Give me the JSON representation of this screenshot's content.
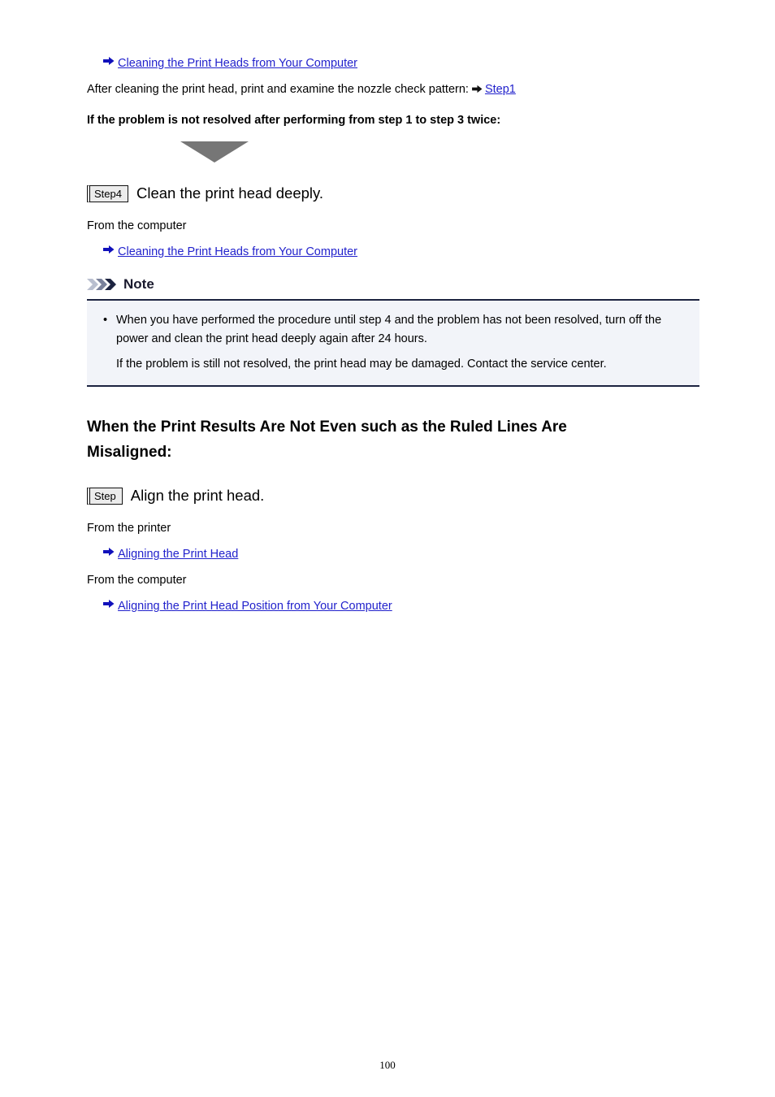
{
  "document": {
    "page_number": "100"
  },
  "top_section": {
    "link_cleaning_computer": "Cleaning the Print Heads from Your Computer",
    "after_clean_text": "After cleaning the print head, print and examine the nozzle check pattern:",
    "step1_link": "Step1",
    "problem_not_resolved": "If the problem is not resolved after performing from step 1 to step 3 twice:"
  },
  "step4": {
    "badge": "Step4",
    "title": "Clean the print head deeply.",
    "from_computer_label": "From the computer",
    "link_cleaning_computer": "Cleaning the Print Heads from Your Computer"
  },
  "note": {
    "title": "Note",
    "bullet": "•",
    "bullet_text": "When you have performed the procedure until step 4 and the problem has not been resolved, turn off the power and clean the print head deeply again after 24 hours.",
    "sub_text": "If the problem is still not resolved, the print head may be damaged. Contact the service center."
  },
  "align_section": {
    "heading": "When the Print Results Are Not Even such as the Ruled Lines Are Misaligned:",
    "badge": "Step",
    "title": "Align the print head.",
    "from_printer_label": "From the printer",
    "link_aligning_print_head": "Aligning the Print Head",
    "from_computer_label": "From the computer",
    "link_aligning_position": "Aligning the Print Head Position from Your Computer"
  },
  "icons": {
    "arrow": "right-arrow-icon",
    "down_triangle": "down-triangle-icon",
    "note_chevrons": "chevrons-right-icon"
  },
  "colors": {
    "link": "#2222cc",
    "note_border": "#1c2340",
    "note_background": "#f2f4f9",
    "triangle": "#767676",
    "badge_background": "#ececec"
  }
}
